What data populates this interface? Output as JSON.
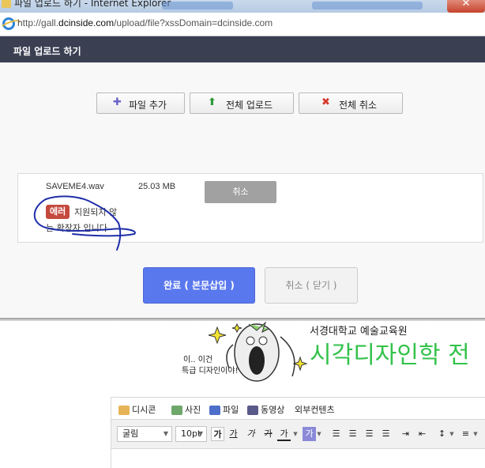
{
  "browser": {
    "window_title": "파일 업로드 하기 - Internet Explorer",
    "url_prefix": "http://gall.",
    "url_domain": "dcinside.com",
    "url_rest": "/upload/file?xssDomain=dcinside.com"
  },
  "dialog": {
    "title": "파일 업로드 하기",
    "buttons": {
      "add_file": "파일 추가",
      "upload_all": "전체 업로드",
      "cancel_all": "전체 취소"
    },
    "file": {
      "name": "SAVEME4.wav",
      "size": "25.03 MB",
      "cancel_label": "취소",
      "error_badge": "에러",
      "error_line1": "지원되지 않",
      "error_line2": "는 확장자 입니다"
    },
    "footer": {
      "done_label": "완료 ( 본문삽입 )",
      "close_label": "취소 ( 닫기 )"
    }
  },
  "background_page": {
    "banner": {
      "school": "서경대학교 예술교육원",
      "headline": "시각디자인학 전",
      "caption1": "이.. 이건",
      "caption2": "특급 디자인이야!"
    },
    "editor": {
      "tabs": [
        "디시콘",
        "사진",
        "파일",
        "동영상",
        "외부컨텐츠"
      ],
      "font_family": "굴림",
      "font_size": "10pt",
      "format_buttons": [
        "가",
        "가",
        "가",
        "가",
        "가"
      ]
    }
  },
  "colors": {
    "dialog_header": "#3a3f52",
    "primary_button": "#5a78ee",
    "error_badge": "#c44a3f",
    "headline_green": "#33c24a",
    "annotation_ink": "#1f2fa8"
  }
}
